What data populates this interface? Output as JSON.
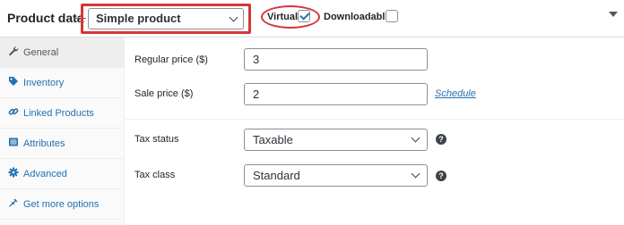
{
  "header": {
    "title": "Product data",
    "separator": "—",
    "product_type": {
      "selected": "Simple product"
    },
    "virtual": {
      "label": "Virtual:",
      "checked": true
    },
    "downloadable": {
      "label": "Downloadable:",
      "checked": false
    }
  },
  "sidebar": {
    "items": [
      {
        "label": "General",
        "icon": "wrench-icon",
        "active": true
      },
      {
        "label": "Inventory",
        "icon": "tag-icon",
        "active": false
      },
      {
        "label": "Linked Products",
        "icon": "link-icon",
        "active": false
      },
      {
        "label": "Attributes",
        "icon": "list-icon",
        "active": false
      },
      {
        "label": "Advanced",
        "icon": "gear-icon",
        "active": false
      },
      {
        "label": "Get more options",
        "icon": "plugin-icon",
        "active": false
      }
    ]
  },
  "general": {
    "regular_price": {
      "label": "Regular price ($)",
      "value": "3"
    },
    "sale_price": {
      "label": "Sale price ($)",
      "value": "2",
      "schedule_link": "Schedule"
    },
    "tax_status": {
      "label": "Tax status",
      "selected": "Taxable",
      "help": "?"
    },
    "tax_class": {
      "label": "Tax class",
      "selected": "Standard",
      "help": "?"
    }
  },
  "colors": {
    "highlight": "#d63638",
    "link": "#2271b1",
    "text": "#1d2327"
  }
}
